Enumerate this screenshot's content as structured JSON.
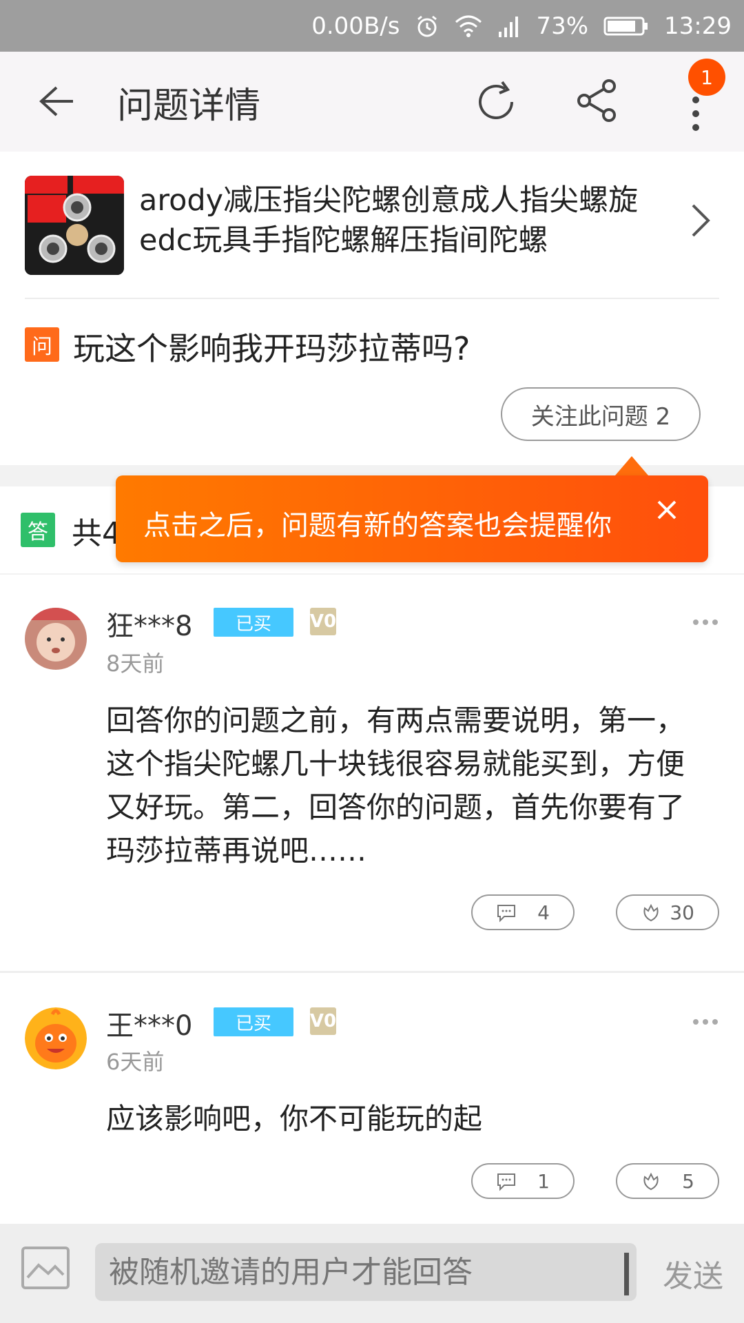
{
  "status": {
    "speed": "0.00B/s",
    "battery": "73%",
    "time": "13:29"
  },
  "header": {
    "title": "问题详情",
    "badge_count": "1"
  },
  "product": {
    "title": "arody减压指尖陀螺创意成人指尖螺旋edc玩具手指陀螺解压指间陀螺"
  },
  "question": {
    "tag": "问",
    "text": "玩这个影响我开玛莎拉蒂吗?",
    "follow_label": "关注此问题 2"
  },
  "answers_header": {
    "tag": "答",
    "count_prefix": "共4"
  },
  "tooltip": {
    "text": "点击之后，问题有新的答案也会提醒你"
  },
  "answers": [
    {
      "user": "狂***8",
      "bought": "已买",
      "level": "V0",
      "time": "8天前",
      "text": "回答你的问题之前，有两点需要说明，第一，这个指尖陀螺几十块钱很容易就能买到，方便又好玩。第二，回答你的问题，首先你要有了玛莎拉蒂再说吧……",
      "comments": "4",
      "likes": "30"
    },
    {
      "user": "王***0",
      "bought": "已买",
      "level": "V0",
      "time": "6天前",
      "text": "应该影响吧，你不可能玩的起",
      "comments": "1",
      "likes": "5"
    }
  ],
  "reply": {
    "placeholder": "被随机邀请的用户才能回答",
    "send_label": "发送"
  },
  "colors": {
    "accent": "#ff5000",
    "bought_badge": "#46c8ff",
    "answer_tag": "#2fbf6a"
  }
}
